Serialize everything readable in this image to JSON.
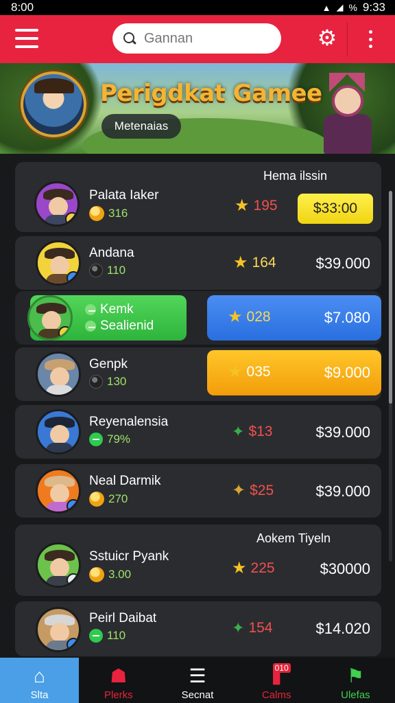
{
  "status_bar": {
    "time_left": "8:00",
    "battery": "%",
    "time_right": "9:33"
  },
  "top_bar": {
    "search_placeholder": "Gannan"
  },
  "banner": {
    "title": "Perigdkat Gamee",
    "chip": "Metenaias"
  },
  "cards": [
    {
      "header": "Hema ilssin",
      "name": "Palata Iaker",
      "sub_icon": "coin-icon",
      "sub": "316",
      "stat_icon": "star-icon",
      "stat": "195",
      "price": "$33:00",
      "price_style": "button"
    },
    {
      "name": "Andana",
      "sub_icon": "orb-icon",
      "sub": "110",
      "stat_icon": "star-icon",
      "stat": "164",
      "price": "$39.000"
    },
    {
      "name": "Kemk",
      "sub_icon": "orb-icon",
      "sub": "Sealienid",
      "stat_icon": "star-icon",
      "stat": "028",
      "price": "$7.080",
      "highlight": "green-blue"
    },
    {
      "name": "Genpk",
      "sub_icon": "orb-icon",
      "sub": "130",
      "stat_icon": "star-icon",
      "stat": "035",
      "price": "$9.000",
      "highlight": "orange"
    },
    {
      "name": "Reyenalensia",
      "sub_icon": "green-dot-icon",
      "sub": "79%",
      "stat_icon": "leaf-icon",
      "stat": "$13",
      "price": "$39.000"
    },
    {
      "name": "Neal Darmik",
      "sub_icon": "coin-icon",
      "sub": "270",
      "stat_icon": "medal-icon",
      "stat": "$25",
      "price": "$39.000"
    },
    {
      "header": "Aokem Tiyeln",
      "name": "Sstuicr Pyank",
      "sub_icon": "coin-icon",
      "sub": "3.00",
      "stat_icon": "star-icon",
      "stat": "225",
      "price": "$30000"
    },
    {
      "name": "Peirl Daibat",
      "sub_icon": "green-dot-icon",
      "sub": "110",
      "stat_icon": "leaf-icon",
      "stat": "154",
      "price": "$14.020"
    }
  ],
  "nav": [
    {
      "label": "Slta",
      "icon": "home-icon",
      "color": "#ffffff",
      "active": true
    },
    {
      "label": "Plerks",
      "icon": "store-icon",
      "color": "#e8233f"
    },
    {
      "label": "Secnat",
      "icon": "stack-icon",
      "color": "#ffffff"
    },
    {
      "label": "Calms",
      "icon": "tag-icon",
      "color": "#e8233f",
      "badge": "010"
    },
    {
      "label": "Ulefas",
      "icon": "flag-icon",
      "color": "#3fd14f"
    }
  ],
  "colors": {
    "accent": "#e8233f",
    "card": "#2b2c30",
    "green": "#9fe36b",
    "gold": "#f5c323",
    "red_value": "#f0514e",
    "yellow_value": "#f8d95a"
  }
}
